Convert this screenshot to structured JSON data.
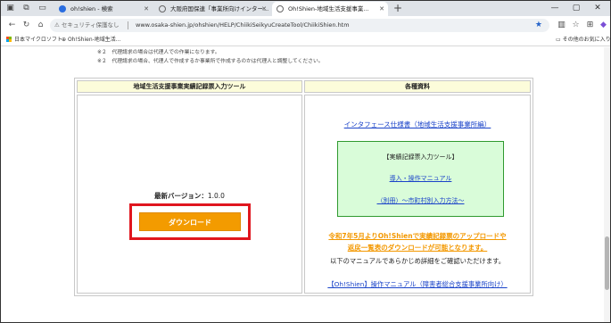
{
  "browser": {
    "tabs": [
      {
        "title": "oh!shien - 検索"
      },
      {
        "title": "大阪府国保連「事業所向けインター..."
      },
      {
        "title": "Oh!Shien-地域生活支援事業..."
      }
    ],
    "security_label": "セキュリティ保護なし",
    "url": "www.osaka-shien.jp/ohshien/HELP/ChiikiSeikyuCreateTool/ChiikiShien.htm",
    "favorites": [
      {
        "label": "日本マイクロソフト"
      },
      {
        "label": "Oh!Shien-地域生活..."
      },
      {
        "label": "その他のお気に入り"
      }
    ],
    "icons": {
      "back": "back-arrow-icon",
      "forward": "forward-arrow-icon",
      "refresh": "refresh-icon",
      "home": "home-icon",
      "star": "star-icon"
    },
    "accent": "#2563c9"
  },
  "notes": [
    "※２　代理請求の場合は代理人での作業になります。",
    "※２　代理請求の場合、代理人で作成するか事業所で作成するのかは代理人と調整してください。"
  ],
  "left_panel": {
    "header": "地域生活支援事業実績記録票入力ツール",
    "version_label": "最新バージョン：",
    "version_value": "1.0.0",
    "download_label": "ダウンロード"
  },
  "right_panel": {
    "header": "各種資料",
    "interface_link": "インタフェース仕様書（地域生活支援事業所編）",
    "box_title": "【実績記録票入力ツール】",
    "manual_link": "導入・操作マニュアル",
    "appendix_link": "（別冊）〜市町村別入力方法〜",
    "notice_line1": "令和7年5月よりOh!Shienで実績記録票のアップロードや",
    "notice_line2": "返戻一覧表のダウンロードが可能となります。",
    "manual_note": "以下のマニュアルであらかじめ詳細をご確認いただけます。",
    "ohshien_manual_link": "【Oh!Shien】操作マニュアル（障害者総合支援事業所向け）"
  },
  "colors": {
    "download_button": "#f39b00",
    "highlight_frame": "#e0161e",
    "header_bg": "#fcfcda",
    "box_bg": "#d9fcd9",
    "box_border": "#2f9a2f",
    "notice_text": "#f39800",
    "link": "#1a43c9"
  }
}
